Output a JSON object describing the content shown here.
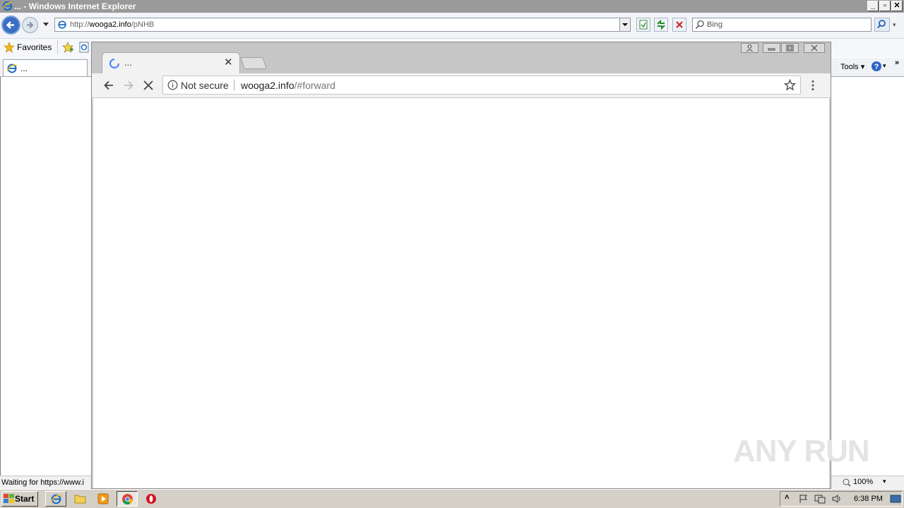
{
  "ie": {
    "title": "... - Windows Internet Explorer",
    "address_prefix": "http://",
    "address_host": "wooga2.info",
    "address_path": "/pNHB",
    "search_placeholder": "Bing",
    "favorites_label": "Favorites",
    "tab_label": "...",
    "tools_label": "Tools",
    "status_text": "Waiting for https://www.i",
    "zoom": "100%"
  },
  "chrome": {
    "tab_title": "...",
    "security_label": "Not secure",
    "url_host": "wooga2.info",
    "url_path": "/#forward"
  },
  "watermark": "ANY RUN",
  "taskbar": {
    "start_label": "Start",
    "clock": "6:38 PM"
  },
  "colors": {
    "ie_titlebar": "#9a9a9a",
    "chrome_frame": "#c6c6c6",
    "taskbar": "#d4d0c8",
    "spinner": "#4285f4"
  }
}
